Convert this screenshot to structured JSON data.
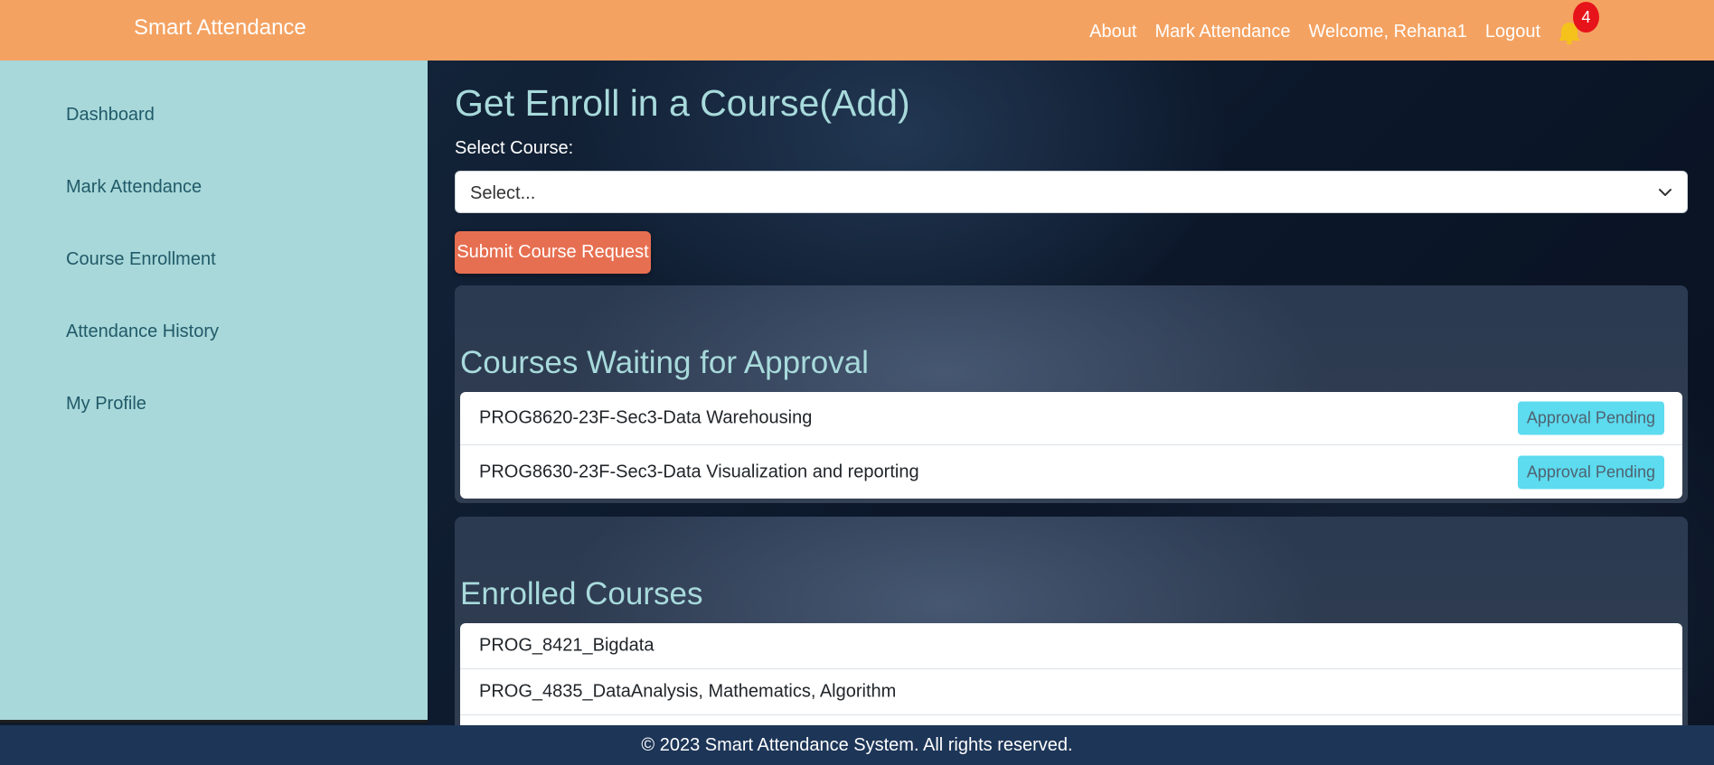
{
  "navbar": {
    "brand": "Smart Attendance",
    "links": [
      "About",
      "Mark Attendance",
      "Welcome, Rehana1",
      "Logout"
    ],
    "notification_count": "4",
    "accent": "#f4a261"
  },
  "sidebar": {
    "items": [
      {
        "label": "Dashboard"
      },
      {
        "label": "Mark Attendance"
      },
      {
        "label": "Course Enrollment"
      },
      {
        "label": "Attendance History"
      },
      {
        "label": "My Profile"
      }
    ]
  },
  "main": {
    "title": "Get Enroll in a Course(Add)",
    "select_label": "Select Course:",
    "select_value": "Select...",
    "submit_label": "Submit Course Request",
    "pending": {
      "heading": "Courses Waiting for Approval",
      "items": [
        {
          "name": "PROG8620-23F-Sec3-Data Warehousing",
          "status": "Approval Pending"
        },
        {
          "name": "PROG8630-23F-Sec3-Data Visualization and reporting",
          "status": "Approval Pending"
        }
      ]
    },
    "enrolled": {
      "heading": "Enrolled Courses",
      "items": [
        {
          "name": "PROG_8421_Bigdata"
        },
        {
          "name": "PROG_4835_DataAnalysis, Mathematics, Algorithm"
        },
        {
          "name": ""
        }
      ]
    }
  },
  "footer": {
    "text": "© 2023 Smart Attendance System. All rights reserved."
  },
  "icons": {
    "bell": "bell-icon",
    "select_arrow": "chevron-down-icon"
  },
  "colors": {
    "sidebar": "#a8d8da",
    "button": "#e76f51",
    "badge": "#e7131a",
    "pill": "#5ddbef",
    "footer": "#1d3557"
  }
}
